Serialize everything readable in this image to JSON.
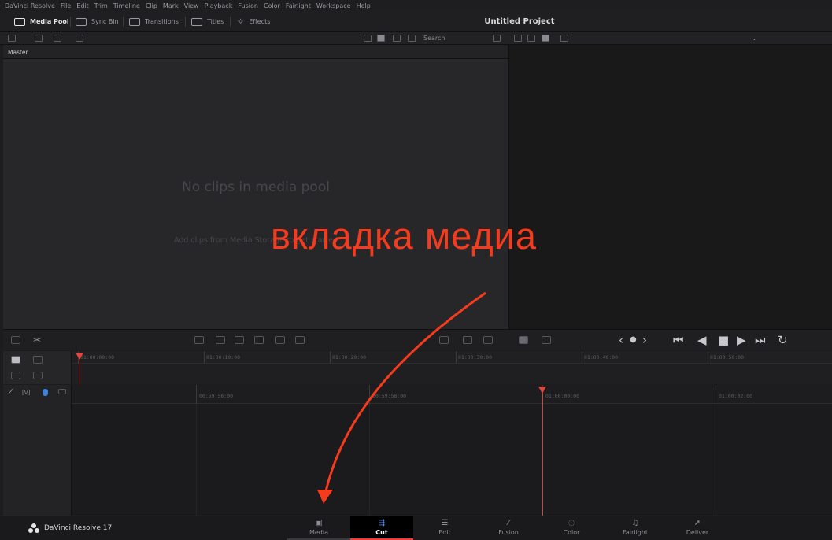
{
  "menubar": {
    "items": [
      "DaVinci Resolve",
      "File",
      "Edit",
      "Trim",
      "Timeline",
      "Clip",
      "Mark",
      "View",
      "Playback",
      "Fusion",
      "Color",
      "Fairlight",
      "Workspace",
      "Help"
    ]
  },
  "toolbar": {
    "media_pool": "Media Pool",
    "sync_bin": "Sync Bin",
    "transitions": "Transitions",
    "titles": "Titles",
    "effects": "Effects"
  },
  "project_title": "Untitled Project",
  "subbar": {
    "search_placeholder": "Search"
  },
  "pool": {
    "bin_name": "Master",
    "empty_title": "No clips in media pool",
    "empty_subtitle": "Add clips from Media Storage to get started"
  },
  "transport": {
    "prev_label": "‹",
    "dot_label": "●",
    "next_label": "›",
    "first_frame": "⏮",
    "reverse": "◀",
    "stop": "■",
    "play": "▶",
    "last_frame": "⏭",
    "loop": "↻"
  },
  "timeline": {
    "upper_ticks": [
      "01:00:00:00",
      "01:00:10:00",
      "01:00:20:00",
      "01:00:30:00",
      "01:00:40:00",
      "01:00:50:00"
    ],
    "lower_ticks": [
      "00:59:56:00",
      "00:59:58:00",
      "01:00:00:00",
      "01:00:02:00"
    ],
    "track_label": "[V]"
  },
  "bottombar": {
    "app_name": "DaVinci Resolve 17",
    "pages": [
      {
        "label": "Media",
        "icon": "media-icon"
      },
      {
        "label": "Cut",
        "icon": "cut-icon"
      },
      {
        "label": "Edit",
        "icon": "edit-icon"
      },
      {
        "label": "Fusion",
        "icon": "fusion-icon"
      },
      {
        "label": "Color",
        "icon": "color-icon"
      },
      {
        "label": "Fairlight",
        "icon": "fairlight-icon"
      },
      {
        "label": "Deliver",
        "icon": "deliver-icon"
      }
    ],
    "active_page": "Cut"
  },
  "annotation": {
    "text": "вкладка медиа",
    "color": "#f53b1d"
  },
  "colors": {
    "playhead": "#e2473e",
    "active_tab_underline": "#f03a3a",
    "cut_icon": "#5b8ff9"
  }
}
